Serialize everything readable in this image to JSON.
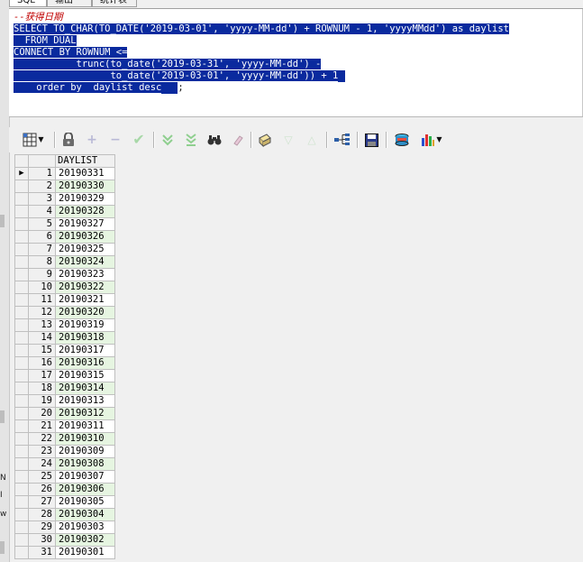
{
  "tabs": [
    {
      "label": "SQL",
      "active": true
    },
    {
      "label": "输出",
      "active": false
    },
    {
      "label": "统计表",
      "active": false
    }
  ],
  "editor": {
    "comment": "--获得日期",
    "lines": [
      {
        "text": "SELECT TO_CHAR(TO_DATE('2019-03-01', 'yyyy-MM-dd') + ROWNUM - 1, 'yyyyMMdd') as daylist",
        "selected": true
      },
      {
        "text": "  FROM DUAL",
        "selected": true
      },
      {
        "text": "CONNECT BY ROWNUM <=",
        "selected": true
      },
      {
        "text": "           trunc(to_date('2019-03-31', 'yyyy-MM-dd') -",
        "selected": true
      },
      {
        "text": "                 to_date('2019-03-01', 'yyyy-MM-dd')) + 1",
        "selected": true
      },
      {
        "text": "    order by  daylist desc",
        "selected": true,
        "after": ";"
      }
    ]
  },
  "toolbar": {
    "icons": [
      "grid-view-icon",
      "lock-icon",
      "add-record-icon",
      "delete-record-icon",
      "post-changes-icon",
      "fetch-next-icon",
      "fetch-last-icon",
      "find-icon",
      "clear-icon",
      "print-icon",
      "sort-descending-icon",
      "sort-ascending-icon",
      "query-tree-icon",
      "save-icon",
      "export-icon",
      "chart-icon"
    ]
  },
  "left_strip": [
    "N",
    "I",
    "w"
  ],
  "grid": {
    "column": "DAYLIST",
    "rows": [
      {
        "n": "1",
        "v": "20190331"
      },
      {
        "n": "2",
        "v": "20190330"
      },
      {
        "n": "3",
        "v": "20190329"
      },
      {
        "n": "4",
        "v": "20190328"
      },
      {
        "n": "5",
        "v": "20190327"
      },
      {
        "n": "6",
        "v": "20190326"
      },
      {
        "n": "7",
        "v": "20190325"
      },
      {
        "n": "8",
        "v": "20190324"
      },
      {
        "n": "9",
        "v": "20190323"
      },
      {
        "n": "10",
        "v": "20190322"
      },
      {
        "n": "11",
        "v": "20190321"
      },
      {
        "n": "12",
        "v": "20190320"
      },
      {
        "n": "13",
        "v": "20190319"
      },
      {
        "n": "14",
        "v": "20190318"
      },
      {
        "n": "15",
        "v": "20190317"
      },
      {
        "n": "16",
        "v": "20190316"
      },
      {
        "n": "17",
        "v": "20190315"
      },
      {
        "n": "18",
        "v": "20190314"
      },
      {
        "n": "19",
        "v": "20190313"
      },
      {
        "n": "20",
        "v": "20190312"
      },
      {
        "n": "21",
        "v": "20190311"
      },
      {
        "n": "22",
        "v": "20190310"
      },
      {
        "n": "23",
        "v": "20190309"
      },
      {
        "n": "24",
        "v": "20190308"
      },
      {
        "n": "25",
        "v": "20190307"
      },
      {
        "n": "26",
        "v": "20190306"
      },
      {
        "n": "27",
        "v": "20190305"
      },
      {
        "n": "28",
        "v": "20190304"
      },
      {
        "n": "29",
        "v": "20190303"
      },
      {
        "n": "30",
        "v": "20190302"
      },
      {
        "n": "31",
        "v": "20190301"
      }
    ]
  },
  "colors": {
    "selection": "#0a2a9e",
    "comment": "#c00000",
    "alt_row": "#e6f5e1"
  }
}
